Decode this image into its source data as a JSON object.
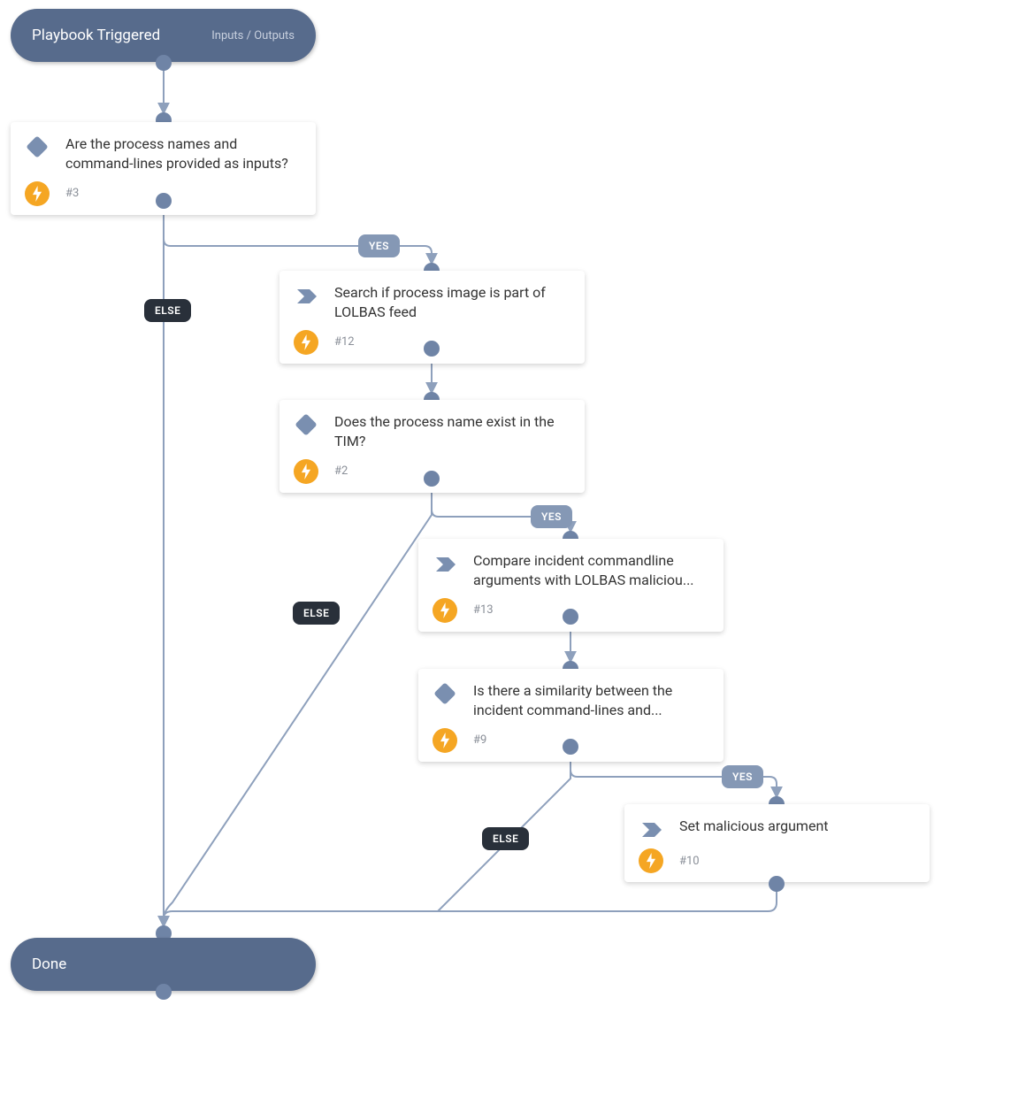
{
  "start": {
    "title": "Playbook Triggered",
    "io_label": "Inputs / Outputs"
  },
  "done": {
    "title": "Done"
  },
  "labels": {
    "yes": "YES",
    "else": "ELSE"
  },
  "nodes": {
    "n3": {
      "text": "Are the process names and command-lines provided as inputs?",
      "step": "#3",
      "type": "decision"
    },
    "n12": {
      "text": "Search if process image is part of LOLBAS feed",
      "step": "#12",
      "type": "action"
    },
    "n2": {
      "text": "Does the process name exist in the TIM?",
      "step": "#2",
      "type": "decision"
    },
    "n13": {
      "text": "Compare incident commandline arguments with LOLBAS maliciou...",
      "step": "#13",
      "type": "action"
    },
    "n9": {
      "text": "Is there a similarity between the incident command-lines and...",
      "step": "#9",
      "type": "decision"
    },
    "n10": {
      "text": "Set malicious argument",
      "step": "#10",
      "type": "action"
    }
  },
  "colors": {
    "node_bg": "#576b8c",
    "port": "#6f84a6",
    "yes_bg": "#8598b5",
    "else_bg": "#29303a",
    "bolt_bg": "#f5a623",
    "connector": "#8ea0bc"
  }
}
